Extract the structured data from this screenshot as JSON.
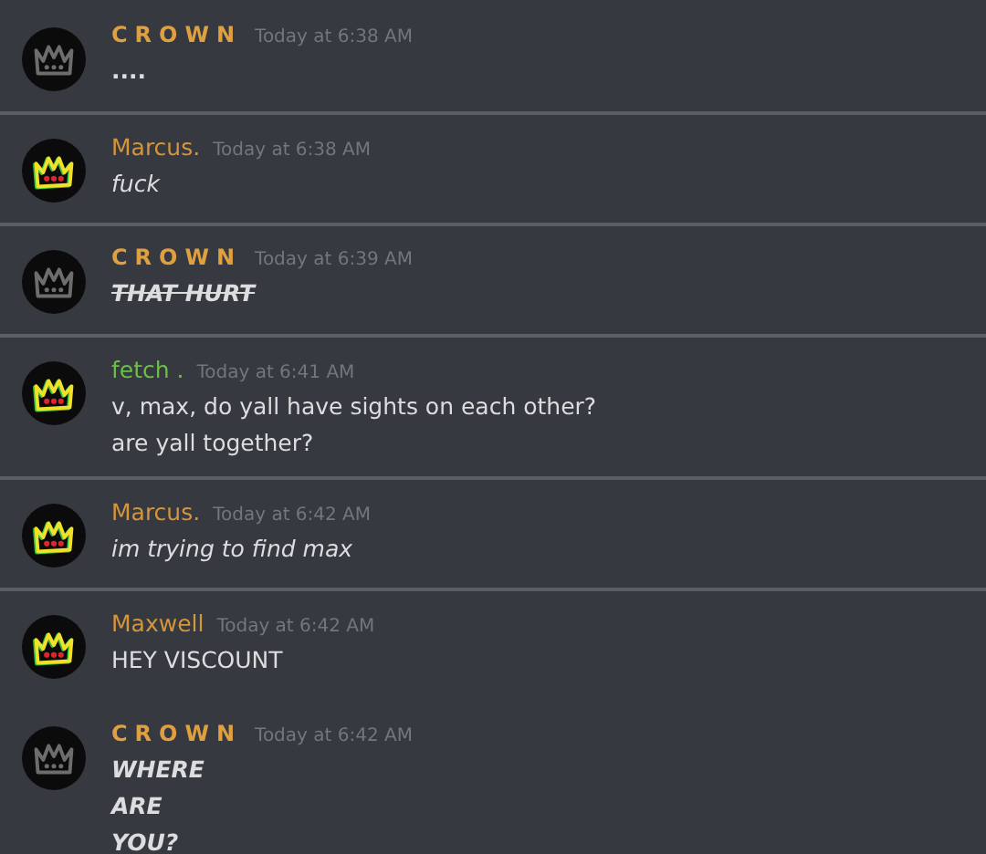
{
  "messages": [
    {
      "author": "CROWN",
      "spaced": true,
      "color": "#e0a040",
      "kind": "grey",
      "time": "Today at 6:38 AM",
      "divider_above": false,
      "lines": [
        {
          "text": "....",
          "kind": "bold"
        }
      ]
    },
    {
      "author": "Marcus.",
      "spaced": false,
      "color": "#d4963c",
      "kind": "colored",
      "time": "Today at 6:38 AM",
      "divider_above": true,
      "lines": [
        {
          "text": "fuck",
          "kind": "italic"
        }
      ]
    },
    {
      "author": "CROWN",
      "spaced": true,
      "color": "#e0a040",
      "kind": "grey",
      "time": "Today at 6:39 AM",
      "divider_above": true,
      "lines": [
        {
          "text": "THAT HURT",
          "kind": "glitch"
        }
      ]
    },
    {
      "author": "fetch .",
      "spaced": false,
      "color": "#6cbf4a",
      "kind": "colored",
      "time": "Today at 6:41 AM",
      "divider_above": true,
      "lines": [
        {
          "text": "v, max, do yall have sights on each other?",
          "kind": "plain"
        },
        {
          "text": "are yall together?",
          "kind": "plain"
        }
      ]
    },
    {
      "author": "Marcus.",
      "spaced": false,
      "color": "#d4963c",
      "kind": "colored",
      "time": "Today at 6:42 AM",
      "divider_above": true,
      "lines": [
        {
          "text": "im trying to find max",
          "kind": "italic"
        }
      ]
    },
    {
      "author": "Maxwell",
      "spaced": false,
      "color": "#d4963c",
      "kind": "colored",
      "time": "Today at 6:42 AM",
      "divider_above": true,
      "lines": [
        {
          "text": "HEY VISCOUNT",
          "kind": "plain"
        }
      ]
    },
    {
      "author": "CROWN",
      "spaced": true,
      "color": "#e0a040",
      "kind": "grey",
      "time": "Today at 6:42 AM",
      "divider_above": false,
      "lines": [
        {
          "text": "WHERE",
          "kind": "bold_italic"
        },
        {
          "text": "ARE",
          "kind": "bold_italic"
        },
        {
          "text": "YOU?",
          "kind": "bold_italic"
        }
      ]
    }
  ]
}
